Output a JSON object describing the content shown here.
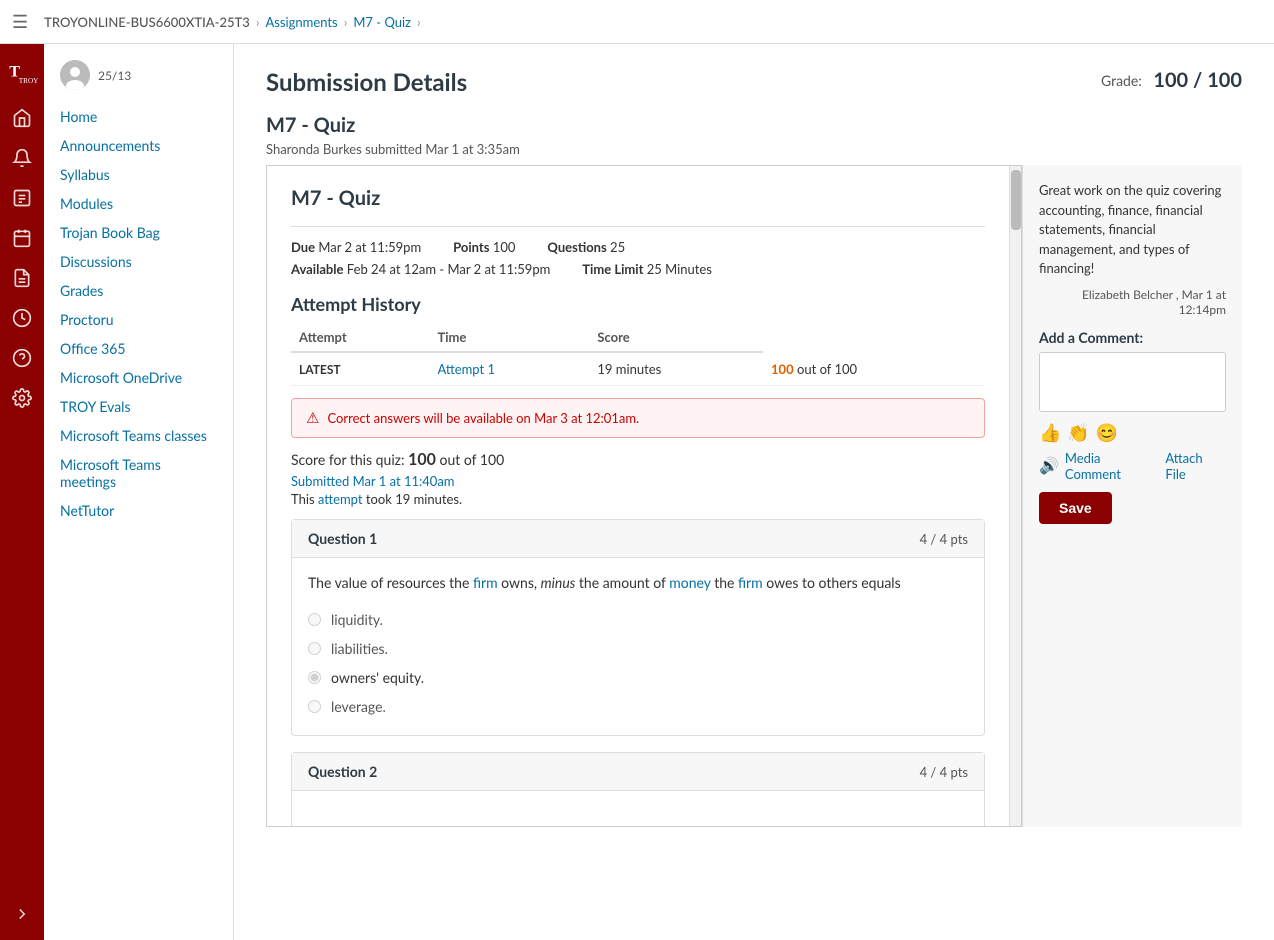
{
  "topnav": {
    "course": "TROYONLINE-BUS6600XTIA-25T3",
    "breadcrumbs": [
      "Assignments",
      "M7 - Quiz"
    ]
  },
  "sidebar": {
    "student_count": "25/13",
    "nav_items": [
      {
        "label": "Home",
        "href": "#"
      },
      {
        "label": "Announcements",
        "href": "#"
      },
      {
        "label": "Syllabus",
        "href": "#"
      },
      {
        "label": "Modules",
        "href": "#"
      },
      {
        "label": "Trojan Book Bag",
        "href": "#"
      },
      {
        "label": "Discussions",
        "href": "#"
      },
      {
        "label": "Grades",
        "href": "#"
      },
      {
        "label": "Proctoru",
        "href": "#"
      },
      {
        "label": "Office 365",
        "href": "#"
      },
      {
        "label": "Microsoft OneDrive",
        "href": "#"
      },
      {
        "label": "TROY Evals",
        "href": "#"
      },
      {
        "label": "Microsoft Teams classes",
        "href": "#"
      },
      {
        "label": "Microsoft Teams meetings",
        "href": "#"
      },
      {
        "label": "NetTutor",
        "href": "#"
      }
    ]
  },
  "submission": {
    "page_title": "Submission Details",
    "grade_label": "Grade:",
    "grade_value": "100 / 100",
    "quiz_title": "M7 - Quiz",
    "submitted_by": "Sharonda Burkes submitted Mar 1 at 3:35am"
  },
  "quiz": {
    "title": "M7 - Quiz",
    "due_label": "Due",
    "due_value": "Mar 2 at 11:59pm",
    "points_label": "Points",
    "points_value": "100",
    "questions_label": "Questions",
    "questions_value": "25",
    "available_label": "Available",
    "available_value": "Feb 24 at 12am - Mar 2 at 11:59pm",
    "time_limit_label": "Time Limit",
    "time_limit_value": "25 Minutes",
    "attempt_history_title": "Attempt History",
    "table_headers": [
      "Attempt",
      "Time",
      "Score"
    ],
    "attempts": [
      {
        "label": "LATEST",
        "attempt": "Attempt 1",
        "time": "19 minutes",
        "score": "100 out of 100"
      }
    ],
    "warning": "Correct answers will be available on Mar 3 at 12:01am.",
    "score_summary": "Score for this quiz: 100 out of 100",
    "submitted_time": "Submitted Mar 1 at 11:40am",
    "took_time": "This attempt took 19 minutes.",
    "questions": [
      {
        "number": "Question 1",
        "pts": "4 / 4 pts",
        "text": "The value of resources the firm owns, minus the amount of money the firm owes to others equals",
        "options": [
          "liquidity.",
          "liabilities.",
          "owners' equity.",
          "leverage."
        ],
        "selected": 2
      },
      {
        "number": "Question 2",
        "pts": "4 / 4 pts",
        "text": "",
        "options": [],
        "selected": -1
      }
    ]
  },
  "comment_panel": {
    "comment_text": "Great work on the quiz covering accounting, finance, financial statements, financial management, and types of financing!",
    "comment_author": "Elizabeth Belcher , Mar 1 at 12:14pm",
    "add_comment_label": "Add a Comment:",
    "emojis": [
      "👍",
      "👏",
      "😊"
    ],
    "media_comment_label": "Media Comment",
    "attach_file_label": "Attach File",
    "save_label": "Save"
  },
  "icons": {
    "hamburger": "☰",
    "home": "⌂",
    "announcements": "🔔",
    "grades": "📋",
    "calendar": "📅",
    "history": "🕐",
    "help": "?",
    "settings": "⚙",
    "collapse": "→"
  }
}
